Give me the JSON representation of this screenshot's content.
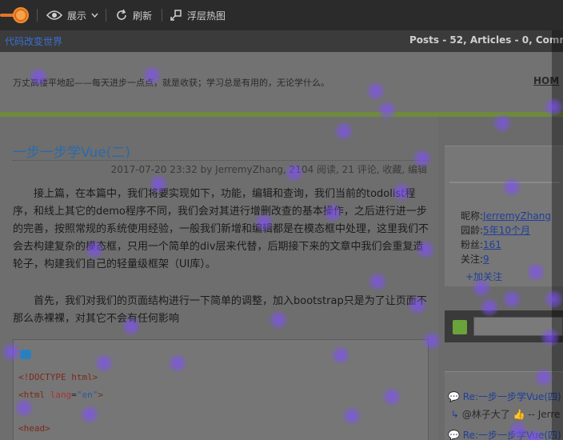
{
  "toolbar": {
    "display_label": "展示",
    "refresh_label": "刷新",
    "float_heatmap_label": "浮层热图"
  },
  "header": {
    "site_name": "代码改变世界",
    "stats": "Posts - 52, Articles - 0, Comme"
  },
  "subheader": {
    "motto": "万丈高楼平地起——每天进步一点点，就是收获；学习总是有用的，无论学什么。",
    "home": "HOM"
  },
  "post": {
    "title": "一步一步学Vue(二)",
    "meta": "2017-07-20 23:32 by JerremyZhang, 2104 阅读, 21 评论, 收藏, 编辑",
    "p1": "接上篇，在本篇中，我们将要实现如下，功能，编辑和查询，我们当前的todolist程序，和线上其它的demo程序不同，我们会对其进行增删改查的基本操作，之后进行进一步的完善，按照常规的系统使用经验，一般我们新增和编辑都是在模态框中处理，这里我们不会去构建复杂的模态框，只用一个简单的div层来代替，后期接下来的文章中我们会重复造轮子，构建我们自己的轻量级框架（UI库）。",
    "p2": "首先，我们对我们的页面结构进行一下简单的调整，加入bootstrap只是为了让页面不那么赤裸裸，对其它不会有任何影响",
    "code": {
      "line1": "<!DOCTYPE html>",
      "line2_tag": "<html ",
      "line2_attr": "lang",
      "line2_eq": "=",
      "line2_val": "\"en\"",
      "line2_end": ">",
      "line3": "<head>"
    }
  },
  "profile": {
    "nickname_label": "昵称:",
    "nickname": "JerremyZhang",
    "age_label": "园龄:",
    "age": "5年10个月",
    "fans_label": "粉丝:",
    "fans": "161",
    "follow_label": "关注:",
    "follow": "9",
    "add_follow": "+加关注"
  },
  "comments": [
    {
      "title": "Re:一步一步学Vue(四)",
      "sub": "@林子大了 👍 -- Jerre"
    },
    {
      "title": "Re:一步一步学Vue(四)",
      "sub": ""
    }
  ],
  "colors": {
    "accent_orange": "#f08a2a",
    "heat_purple": "#804eff",
    "link_blue": "#2b6aa8",
    "green_bar": "#6e8a3d"
  }
}
